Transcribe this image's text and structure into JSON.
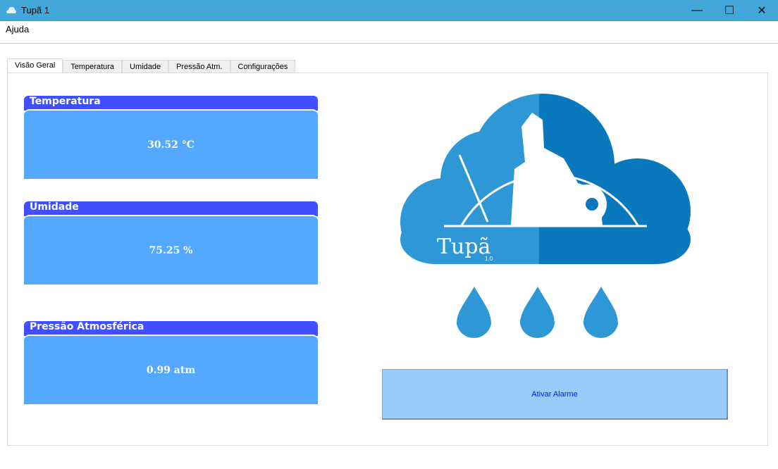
{
  "window": {
    "title": "Tupã 1"
  },
  "menu": {
    "help": "Ajuda"
  },
  "tabs": [
    "Visão Geral",
    "Temperatura",
    "Umidade",
    "Pressão Atm.",
    "Configurações"
  ],
  "panels": [
    {
      "title": "Temperatura",
      "value": "30.52 °C"
    },
    {
      "title": "Umidade",
      "value": "75.25 %"
    },
    {
      "title": "Pressão Atmosférica",
      "value": "0.99 atm"
    }
  ],
  "logo": {
    "name": "Tupã",
    "version": "1.0"
  },
  "alarm_button": "Ativar Alarme",
  "colors": {
    "titlebar": "#41a8d9",
    "panel_header": "#4150ff",
    "panel_body": "#55a8ff",
    "cloud_left": "#2e98d6",
    "cloud_right": "#0a78bd",
    "button": "#99cbfb"
  }
}
